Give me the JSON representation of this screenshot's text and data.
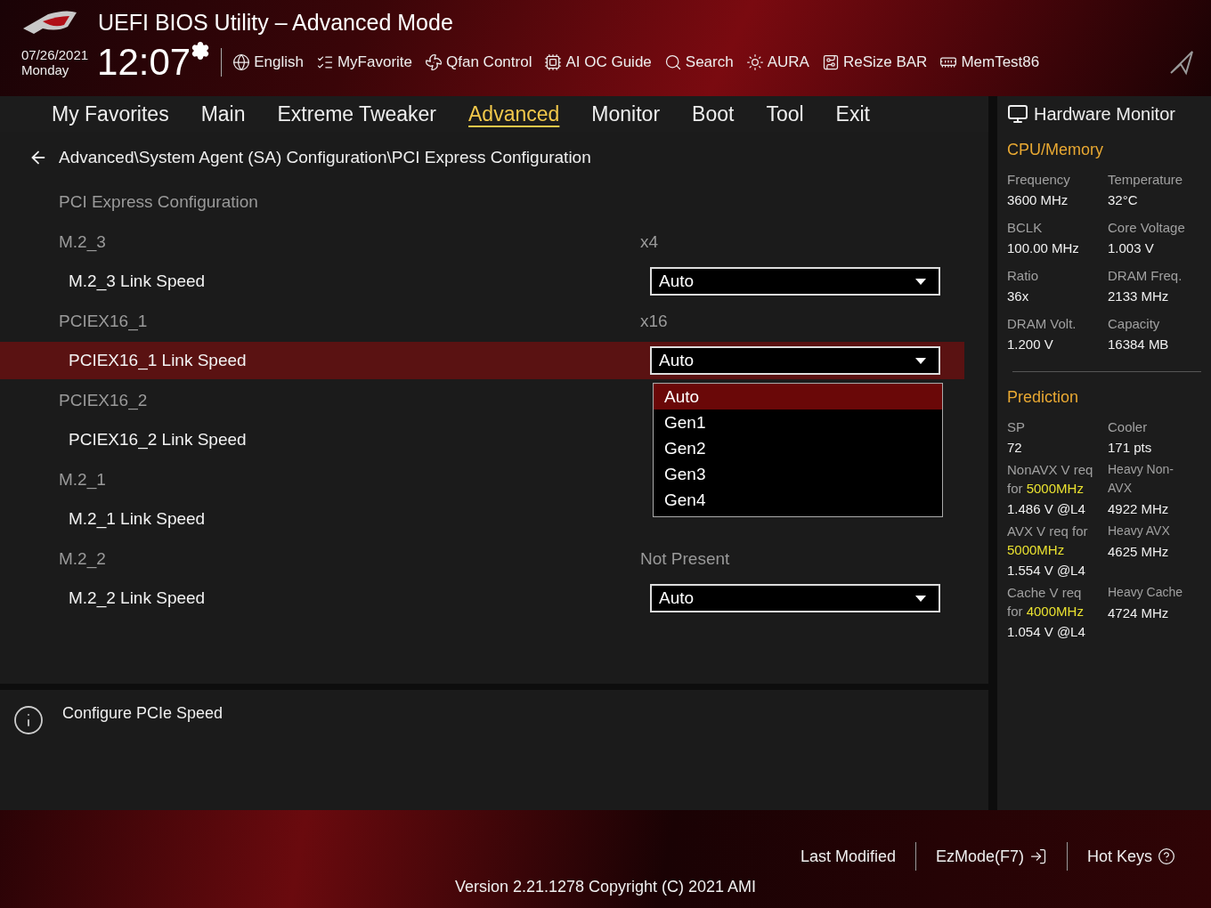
{
  "header": {
    "title": "UEFI BIOS Utility – Advanced Mode",
    "date": "07/26/2021",
    "weekday": "Monday",
    "time": "12:07",
    "tools": [
      {
        "kind": "language",
        "label": "English"
      },
      {
        "kind": "favorite",
        "label": "MyFavorite"
      },
      {
        "kind": "fan",
        "label": "Qfan Control"
      },
      {
        "kind": "ai",
        "label": "AI OC Guide"
      },
      {
        "kind": "search",
        "label": "Search"
      },
      {
        "kind": "aura",
        "label": "AURA"
      },
      {
        "kind": "resize",
        "label": "ReSize BAR"
      },
      {
        "kind": "memtest",
        "label": "MemTest86"
      }
    ]
  },
  "tabs": [
    {
      "label": "My Favorites",
      "selected": false
    },
    {
      "label": "Main",
      "selected": false
    },
    {
      "label": "Extreme Tweaker",
      "selected": false
    },
    {
      "label": "Advanced",
      "selected": true
    },
    {
      "label": "Monitor",
      "selected": false
    },
    {
      "label": "Boot",
      "selected": false
    },
    {
      "label": "Tool",
      "selected": false
    },
    {
      "label": "Exit",
      "selected": false
    }
  ],
  "breadcrumb": "Advanced\\System Agent (SA) Configuration\\PCI Express Configuration",
  "items": [
    {
      "kind": "heading",
      "label": "PCI Express Configuration"
    },
    {
      "kind": "info",
      "label": "M.2_3",
      "value": "x4"
    },
    {
      "kind": "select",
      "label": "M.2_3 Link Speed",
      "value": "Auto",
      "selected": false
    },
    {
      "kind": "info",
      "label": "PCIEX16_1",
      "value": "x16"
    },
    {
      "kind": "select",
      "label": "PCIEX16_1 Link Speed",
      "value": "Auto",
      "selected": true,
      "options": [
        {
          "label": "Auto",
          "selected": true
        },
        {
          "label": "Gen1",
          "selected": false
        },
        {
          "label": "Gen2",
          "selected": false
        },
        {
          "label": "Gen3",
          "selected": false
        },
        {
          "label": "Gen4",
          "selected": false
        }
      ]
    },
    {
      "kind": "info",
      "label": "PCIEX16_2"
    },
    {
      "kind": "select",
      "label": "PCIEX16_2 Link Speed",
      "selected": false
    },
    {
      "kind": "info",
      "label": "M.2_1"
    },
    {
      "kind": "select",
      "label": "M.2_1 Link Speed",
      "selected": false
    },
    {
      "kind": "info",
      "label": "M.2_2",
      "value": "Not Present"
    },
    {
      "kind": "select",
      "label": "M.2_2 Link Speed",
      "value": "Auto",
      "selected": false
    }
  ],
  "help": "Configure PCIe Speed",
  "hardware_monitor": {
    "title": "Hardware Monitor",
    "cpu_memory": {
      "title": "CPU/Memory",
      "stats": [
        {
          "label": "Frequency",
          "value": "3600 MHz"
        },
        {
          "label": "Temperature",
          "value": "32°C"
        },
        {
          "label": "BCLK",
          "value": "100.00 MHz"
        },
        {
          "label": "Core Voltage",
          "value": "1.003 V"
        },
        {
          "label": "Ratio",
          "value": "36x"
        },
        {
          "label": "DRAM Freq.",
          "value": "2133 MHz"
        },
        {
          "label": "DRAM Volt.",
          "value": "1.200 V"
        },
        {
          "label": "Capacity",
          "value": "16384 MB"
        }
      ]
    },
    "prediction": {
      "title": "Prediction",
      "stats": [
        {
          "label": "SP",
          "value": "72"
        },
        {
          "label": "Cooler",
          "value": "171 pts"
        }
      ],
      "rows": [
        {
          "left": {
            "label": "NonAVX V req for",
            "target": "5000MHz",
            "value": "1.486 V @L4"
          },
          "right": {
            "label": "Heavy Non-AVX",
            "value": "4922 MHz"
          }
        },
        {
          "left": {
            "label": "AVX V req for",
            "target": "5000MHz",
            "value": "1.554 V @L4"
          },
          "right": {
            "label": "Heavy AVX",
            "value": "4625 MHz"
          }
        },
        {
          "left": {
            "label": "Cache V req for",
            "target": "4000MHz",
            "value": "1.054 V @L4"
          },
          "right": {
            "label": "Heavy Cache",
            "value": "4724 MHz"
          }
        }
      ]
    }
  },
  "footer": {
    "actions": [
      {
        "kind": "last",
        "label": "Last Modified"
      },
      {
        "kind": "ezmode",
        "label": "EzMode(F7)"
      },
      {
        "kind": "hotkeys",
        "label": "Hot Keys"
      }
    ],
    "version": "Version 2.21.1278 Copyright (C) 2021 AMI"
  }
}
